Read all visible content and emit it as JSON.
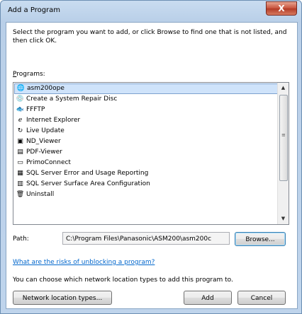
{
  "window": {
    "title": "Add a Program",
    "close_label": "X"
  },
  "instructions": "Select the program you want to add, or click Browse to find one that is not listed, and then click OK.",
  "programs_label": "Programs:",
  "programs": [
    {
      "label": "asm200ope",
      "icon": "globe-icon",
      "glyph": "🌐",
      "selected": true
    },
    {
      "label": "Create a System Repair Disc",
      "icon": "repair-disc-icon",
      "glyph": "💿",
      "selected": false
    },
    {
      "label": "FFFTP",
      "icon": "ffftp-icon",
      "glyph": "🐟",
      "selected": false
    },
    {
      "label": "Internet Explorer",
      "icon": "internet-explorer-icon",
      "glyph": "ℯ",
      "selected": false
    },
    {
      "label": "Live Update",
      "icon": "live-update-icon",
      "glyph": "↻",
      "selected": false
    },
    {
      "label": "ND_Viewer",
      "icon": "nd-viewer-icon",
      "glyph": "▣",
      "selected": false
    },
    {
      "label": "PDF-Viewer",
      "icon": "pdf-viewer-icon",
      "glyph": "▤",
      "selected": false
    },
    {
      "label": "PrimoConnect",
      "icon": "window-icon",
      "glyph": "▭",
      "selected": false
    },
    {
      "label": "SQL Server Error and Usage Reporting",
      "icon": "sql-report-icon",
      "glyph": "▦",
      "selected": false
    },
    {
      "label": "SQL Server Surface Area Configuration",
      "icon": "sql-config-icon",
      "glyph": "▥",
      "selected": false
    },
    {
      "label": "Uninstall",
      "icon": "uninstall-icon",
      "glyph": "🗑",
      "selected": false
    }
  ],
  "scroll": {
    "up": "▲",
    "down": "▼",
    "grip": "≡"
  },
  "path_label": "Path:",
  "path_value": "C:\\Program Files\\Panasonic\\ASM200\\asm200c",
  "browse_label": "Browse...",
  "risk_link": "What are the risks of unblocking a program?",
  "network_note": "You can choose which network location types to add this program to.",
  "network_button": "Network location types...",
  "add_button": "Add",
  "cancel_button": "Cancel"
}
